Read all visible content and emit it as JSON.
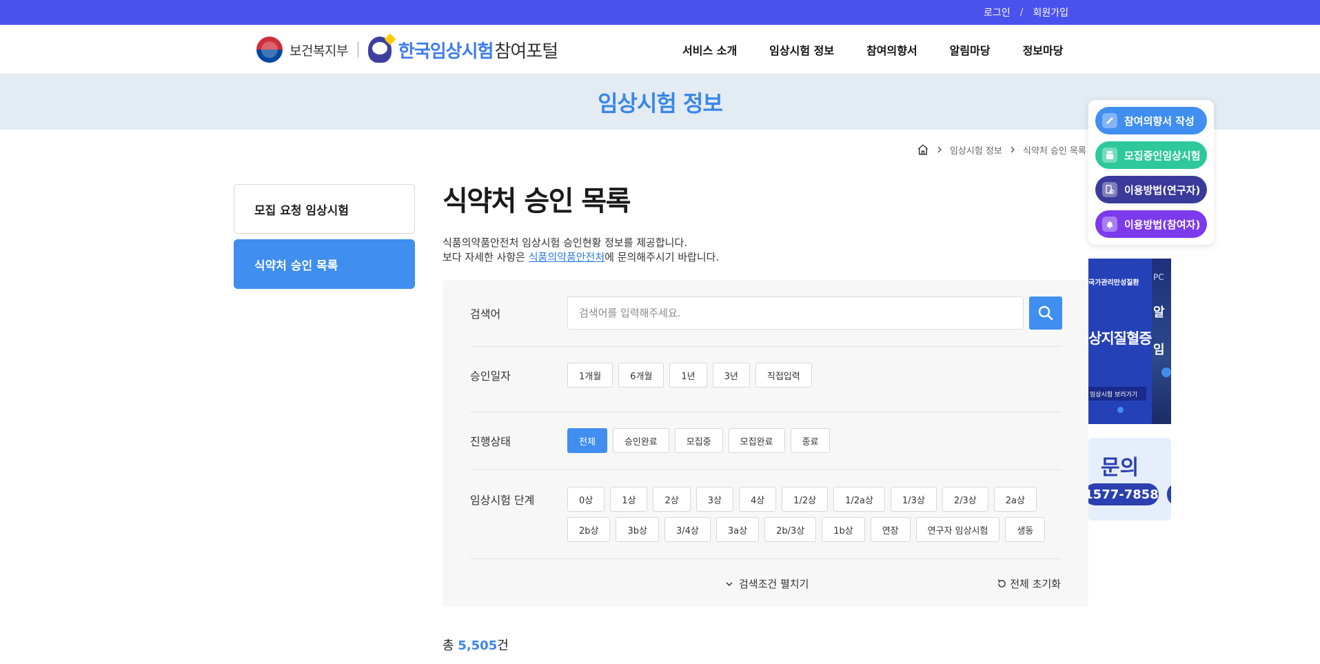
{
  "topbar": {
    "login": "로그인",
    "separator": "/",
    "signup": "회원가입"
  },
  "header": {
    "ministry": "보건복지부",
    "portal_name": "한국임상시험",
    "portal_sub": "참여포털",
    "nav": [
      "서비스 소개",
      "임상시험 정보",
      "참여의향서",
      "알림마당",
      "정보마당"
    ]
  },
  "title_band": {
    "title": "임상시험 정보"
  },
  "breadcrumb": {
    "items": [
      "임상시험 정보",
      "식약처 승인 목록"
    ]
  },
  "side_nav": {
    "items": [
      {
        "label": "모집 요청 임상시험",
        "active": false
      },
      {
        "label": "식약처 승인 목록",
        "active": true
      }
    ]
  },
  "content": {
    "heading": "식약처 승인 목록",
    "desc_line1": "식품의약품안전처 임상시험 승인현황 정보를 제공합니다.",
    "desc_line2_pre": "보다 자세한 사항은 ",
    "desc_link": "식품의약품안전처",
    "desc_line2_post": "에 문의해주시기 바랍니다."
  },
  "search": {
    "keyword_label": "검색어",
    "keyword_placeholder": "검색어를 입력해주세요.",
    "approval_date_label": "승인일자",
    "approval_date_options": [
      "1개월",
      "6개월",
      "1년",
      "3년",
      "직접입력"
    ],
    "status_label": "진행상태",
    "status_options": [
      "전체",
      "승인완료",
      "모집중",
      "모집완료",
      "종료"
    ],
    "status_selected": "전체",
    "phase_label": "임상시험 단계",
    "phase_options": [
      "0상",
      "1상",
      "2상",
      "3상",
      "4상",
      "1/2상",
      "1/2a상",
      "1/3상",
      "2/3상",
      "2a상",
      "2b상",
      "3b상",
      "3/4상",
      "3a상",
      "2b/3상",
      "1b상",
      "연장",
      "연구자 임상시험",
      "생동"
    ],
    "expand_label": "검색조건 펼치기",
    "reset_label": "전체 초기화"
  },
  "result": {
    "prefix": "총 ",
    "count": "5,505",
    "suffix": "건"
  },
  "quick_menu": [
    {
      "label": "참여의향서 작성",
      "color": "#3f8ef0",
      "icon": "pencil-icon"
    },
    {
      "label": "모집중인임상시험",
      "color": "#2ec99a",
      "icon": "medicine-icon"
    },
    {
      "label": "이용방법(연구자)",
      "color": "#3a3a9a",
      "icon": "researcher-icon"
    },
    {
      "label": "이용방법(참여자)",
      "color": "#7c3aed",
      "icon": "participant-icon"
    }
  ],
  "banner": {
    "top_text": "국가관리만성질환",
    "title": "상지질혈증",
    "pill": "임상시험 보러가기",
    "side_text": "PC",
    "side_big1": "알",
    "side_big2": "임"
  },
  "inquiry": {
    "title": "문의",
    "phone": "1577-7858"
  },
  "colors": {
    "topbar": "#4a52ee",
    "accent": "#3f8ef0",
    "title": "#3a86e8"
  }
}
